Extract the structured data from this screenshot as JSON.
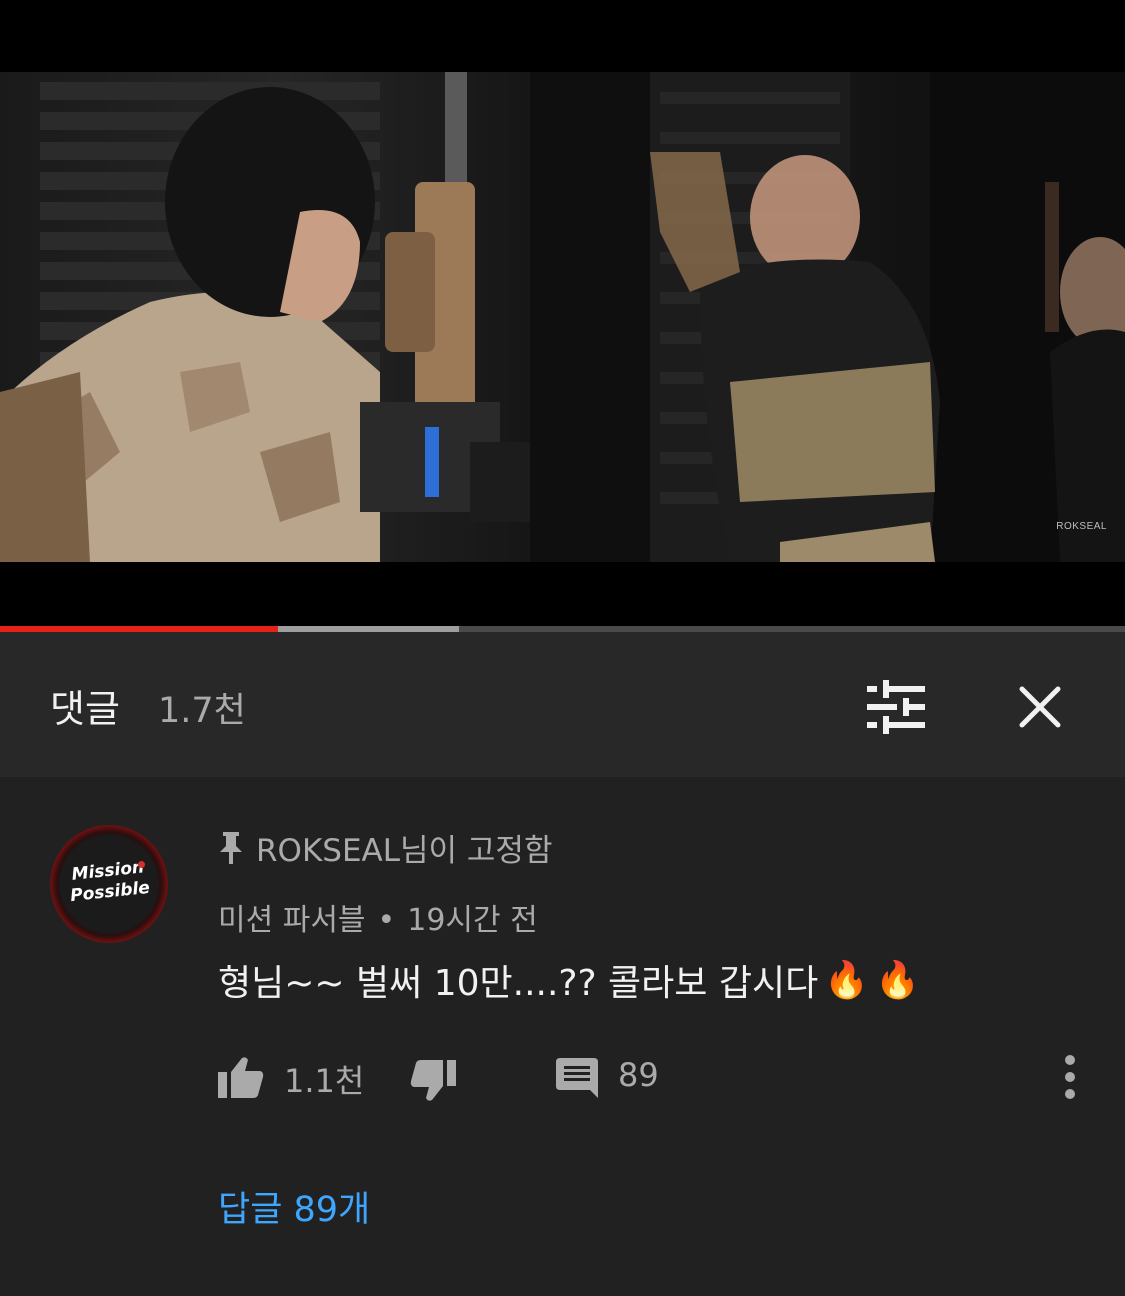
{
  "video": {
    "watermark": "ROKSEAL",
    "progress": {
      "played": 0.247,
      "buffered": 0.408
    }
  },
  "comments_panel": {
    "title": "댓글",
    "count": "1.7천",
    "sort_icon": "sort-sliders-icon",
    "close_icon": "close-icon"
  },
  "comment": {
    "avatar_text_line1": "Mission",
    "avatar_text_line2": "Possible",
    "pinned_label": "ROKSEAL님이 고정함",
    "author": "미션 파서블",
    "separator": "•",
    "time": "19시간 전",
    "text": "형님~~ 벌써 10만....?? 콜라보 갑시다",
    "emoji": "🔥",
    "like_count": "1.1천",
    "reply_count": "89",
    "replies_link": "답글 89개",
    "colors": {
      "link": "#3ea6ff",
      "progress_played": "#e62117"
    }
  }
}
